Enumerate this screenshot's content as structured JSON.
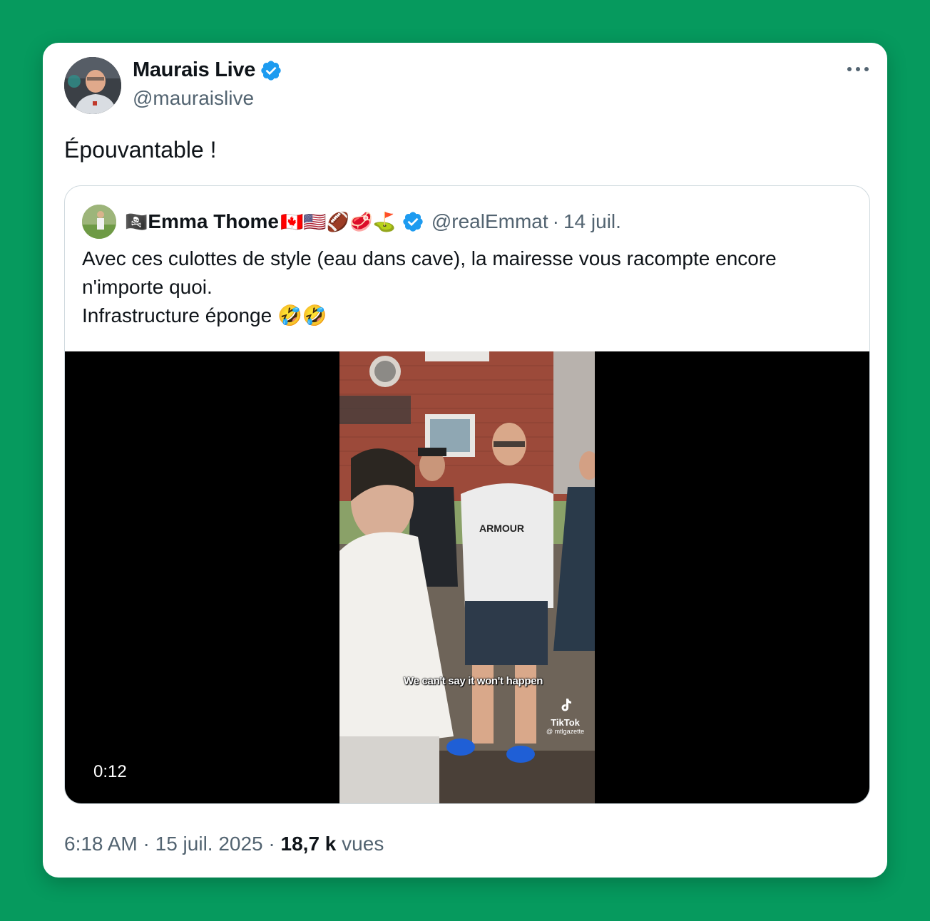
{
  "tweet": {
    "author_name": "Maurais Live",
    "author_handle": "@mauraislive",
    "text": "Épouvantable !",
    "time": "6:18 AM",
    "date": "15 juil. 2025",
    "views_count": "18,7 k",
    "views_label": "vues"
  },
  "quote": {
    "author_prefix_emoji": "🏴‍☠️",
    "author_name": "Emma Thome",
    "author_emojis": "🇨🇦🇺🇸🏈🥩⛳",
    "author_handle": "@realEmmat",
    "date": "14 juil.",
    "text_lines": [
      "Avec ces culottes de style (eau dans cave), la mairesse vous racompte encore",
      "n'importe quoi.",
      "Infrastructure éponge 🤣🤣"
    ],
    "video": {
      "duration": "0:12",
      "subtitle": "We can't say it won't happen",
      "watermark_brand": "TikTok",
      "watermark_handle": "@ mtlgazette",
      "shirt_text": "ARMOUR"
    }
  },
  "colors": {
    "background": "#069a5e",
    "verified": "#1d9bf0",
    "secondary_text": "#536471"
  },
  "icons": [
    "verified-badge-icon",
    "more-options-icon",
    "tiktok-icon"
  ]
}
